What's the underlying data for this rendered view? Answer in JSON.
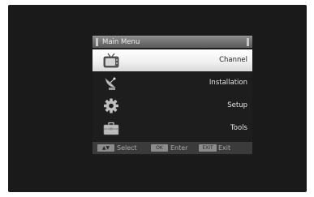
{
  "menu": {
    "title": "Main Menu",
    "items": [
      {
        "label": "Channel",
        "icon": "tv-icon",
        "selected": true
      },
      {
        "label": "Installation",
        "icon": "satellite-dish-icon",
        "selected": false
      },
      {
        "label": "Setup",
        "icon": "gear-icon",
        "selected": false
      },
      {
        "label": "Tools",
        "icon": "toolbox-icon",
        "selected": false
      }
    ]
  },
  "footer": {
    "select_key": "▲▼",
    "select_label": "Select",
    "ok_key": "OK",
    "ok_label": "Enter",
    "exit_key": "EXIT",
    "exit_label": "Exit"
  },
  "colors": {
    "background": "#1a1a1a",
    "selected_bg": "#f1f1f1",
    "title_bar": "#7a7a7a",
    "footer_bar": "#3b3b3b"
  }
}
